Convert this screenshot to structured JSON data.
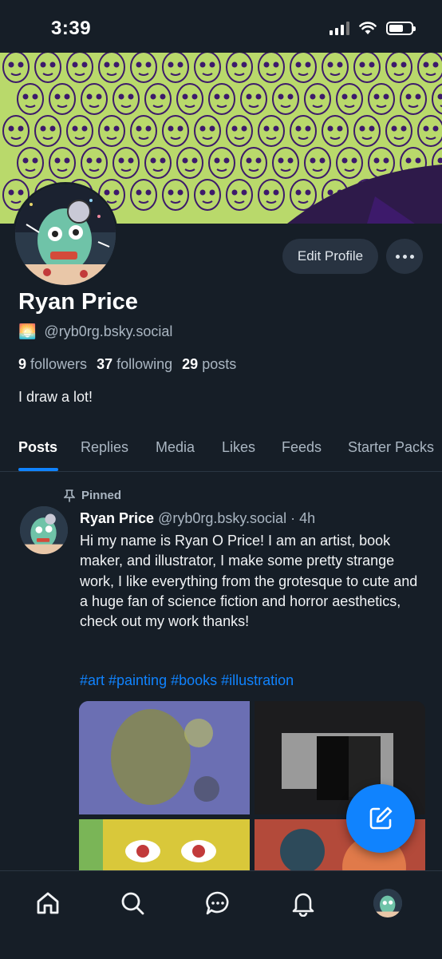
{
  "status_bar": {
    "time": "3:39",
    "battery_level": 0.65
  },
  "profile": {
    "name": "Ryan Price",
    "emoji": "🌅",
    "handle": "@ryb0rg.bsky.social",
    "followers_count": "9",
    "followers_label": "followers",
    "following_count": "37",
    "following_label": "following",
    "posts_count": "29",
    "posts_label": "posts",
    "bio": "I draw a lot!",
    "edit_label": "Edit Profile"
  },
  "tabs": [
    {
      "label": "Posts",
      "active": true
    },
    {
      "label": "Replies"
    },
    {
      "label": "Media"
    },
    {
      "label": "Likes"
    },
    {
      "label": "Feeds"
    },
    {
      "label": "Starter Packs"
    }
  ],
  "post": {
    "pinned_label": "Pinned",
    "author": "Ryan Price",
    "handle": "@ryb0rg.bsky.social",
    "time": "· 4h",
    "text": "Hi my name is Ryan O Price! I am an artist, book maker, and illustrator, I make some pretty strange work, I like everything from the grotesque to cute and a huge fan of science fiction and horror aesthetics, check out my work thanks!",
    "tags": "#art #painting #books #illustration",
    "image_count": 4
  },
  "nav": [
    {
      "icon": "home-icon"
    },
    {
      "icon": "search-icon"
    },
    {
      "icon": "chat-icon"
    },
    {
      "icon": "bell-icon"
    },
    {
      "icon": "profile-avatar"
    }
  ],
  "colors": {
    "background": "#161e27",
    "accent": "#1083fe",
    "banner": "#b9d96b",
    "banner_ink": "#3d1a6b"
  }
}
